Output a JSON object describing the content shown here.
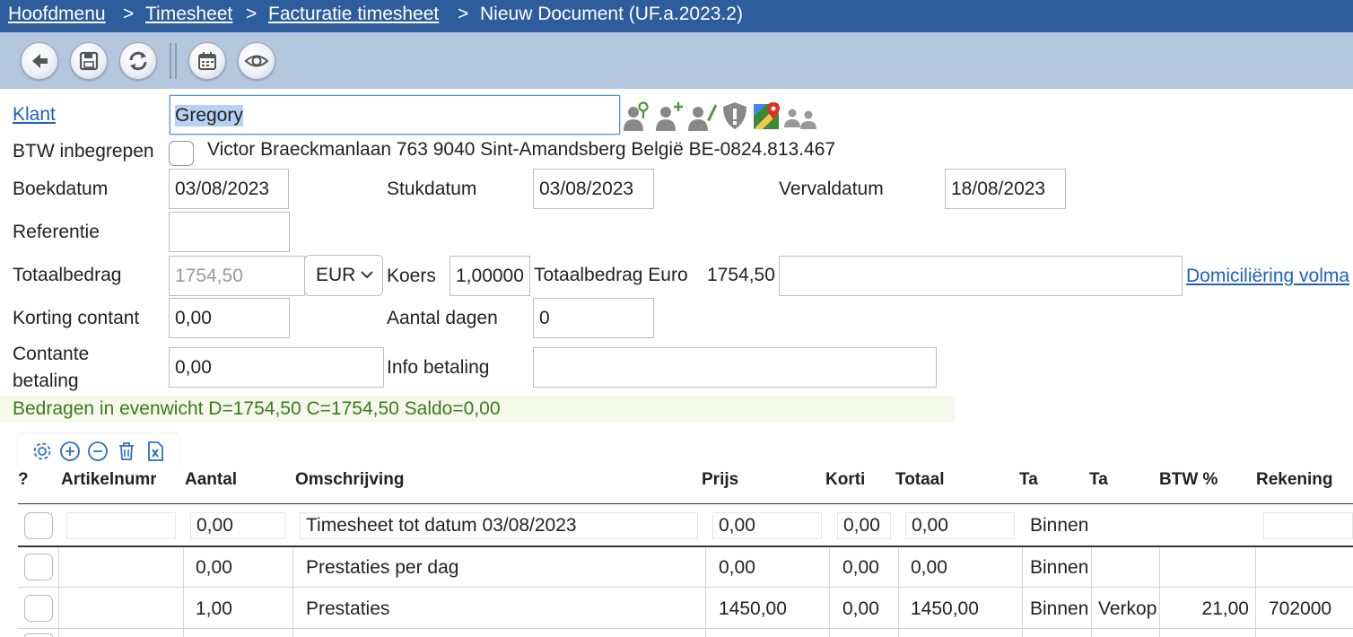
{
  "breadcrumb": {
    "home": "Hoofdmenu",
    "sep1": ">",
    "timesheet": "Timesheet",
    "sep2": ">",
    "invoicing": "Facturatie timesheet",
    "sep3": ">",
    "current": "Nieuw Document (UF.a.2023.2)"
  },
  "toolbar": {
    "buttons": [
      "back-icon",
      "save-icon",
      "refresh-icon",
      "calendar-icon",
      "eye-icon"
    ]
  },
  "form": {
    "klant_label": "Klant",
    "klant_value": "Gregory",
    "btw_label": "BTW inbegrepen",
    "address": "Victor Braeckmanlaan 763 9040 Sint-Amandsberg België BE-0824.813.467",
    "boekdatum_label": "Boekdatum",
    "boekdatum": "03/08/2023",
    "stukdatum_label": "Stukdatum",
    "stukdatum": "03/08/2023",
    "vervaldatum_label": "Vervaldatum",
    "vervaldatum": "18/08/2023",
    "referentie_label": "Referentie",
    "referentie": "",
    "totaalbedrag_label": "Totaalbedrag",
    "totaalbedrag": "1754,50",
    "currency": "EUR",
    "koers_label": "Koers",
    "koers": "1,00000",
    "totaal_euro_label": "Totaalbedrag Euro",
    "totaal_euro": "1754,50",
    "domiciliering_link": "Domiciliëring volma",
    "korting_label": "Korting contant",
    "korting": "0,00",
    "aantal_dagen_label": "Aantal dagen",
    "aantal_dagen": "0",
    "contante_label_1": "Contante",
    "contante_label_2": "betaling",
    "contante": "0,00",
    "info_label": "Info betaling",
    "info": "",
    "balance": "Bedragen in evenwicht D=1754,50 C=1754,50 Saldo=0,00"
  },
  "grid": {
    "tool_icons": [
      "settings-icon",
      "add-row-icon",
      "remove-row-icon",
      "delete-icon",
      "excel-icon"
    ],
    "headers": {
      "q": "?",
      "artikel": "Artikelnumr",
      "aantal": "Aantal",
      "omschrijving": "Omschrijving",
      "prijs": "Prijs",
      "korting": "Korti",
      "totaal": "Totaal",
      "ta1": "Ta",
      "ta2": "Ta",
      "btw": "BTW %",
      "rekening": "Rekening"
    },
    "rows": [
      {
        "artikel": "",
        "aantal": "0,00",
        "omschrijving": "Timesheet tot datum 03/08/2023",
        "prijs": "0,00",
        "korting": "0,00",
        "totaal": "0,00",
        "ta1": "Binnen",
        "ta2": "",
        "btw": "",
        "rekening": ""
      },
      {
        "artikel": "",
        "aantal": "0,00",
        "omschrijving": "Prestaties per dag",
        "prijs": "0,00",
        "korting": "0,00",
        "totaal": "0,00",
        "ta1": "Binnen",
        "ta2": "",
        "btw": "",
        "rekening": ""
      },
      {
        "artikel": "",
        "aantal": "1,00",
        "omschrijving": "Prestaties",
        "prijs": "1450,00",
        "korting": "0,00",
        "totaal": "1450,00",
        "ta1": "Binnen",
        "ta2": "Verkope",
        "btw": "21,00",
        "rekening": "702000"
      }
    ]
  }
}
